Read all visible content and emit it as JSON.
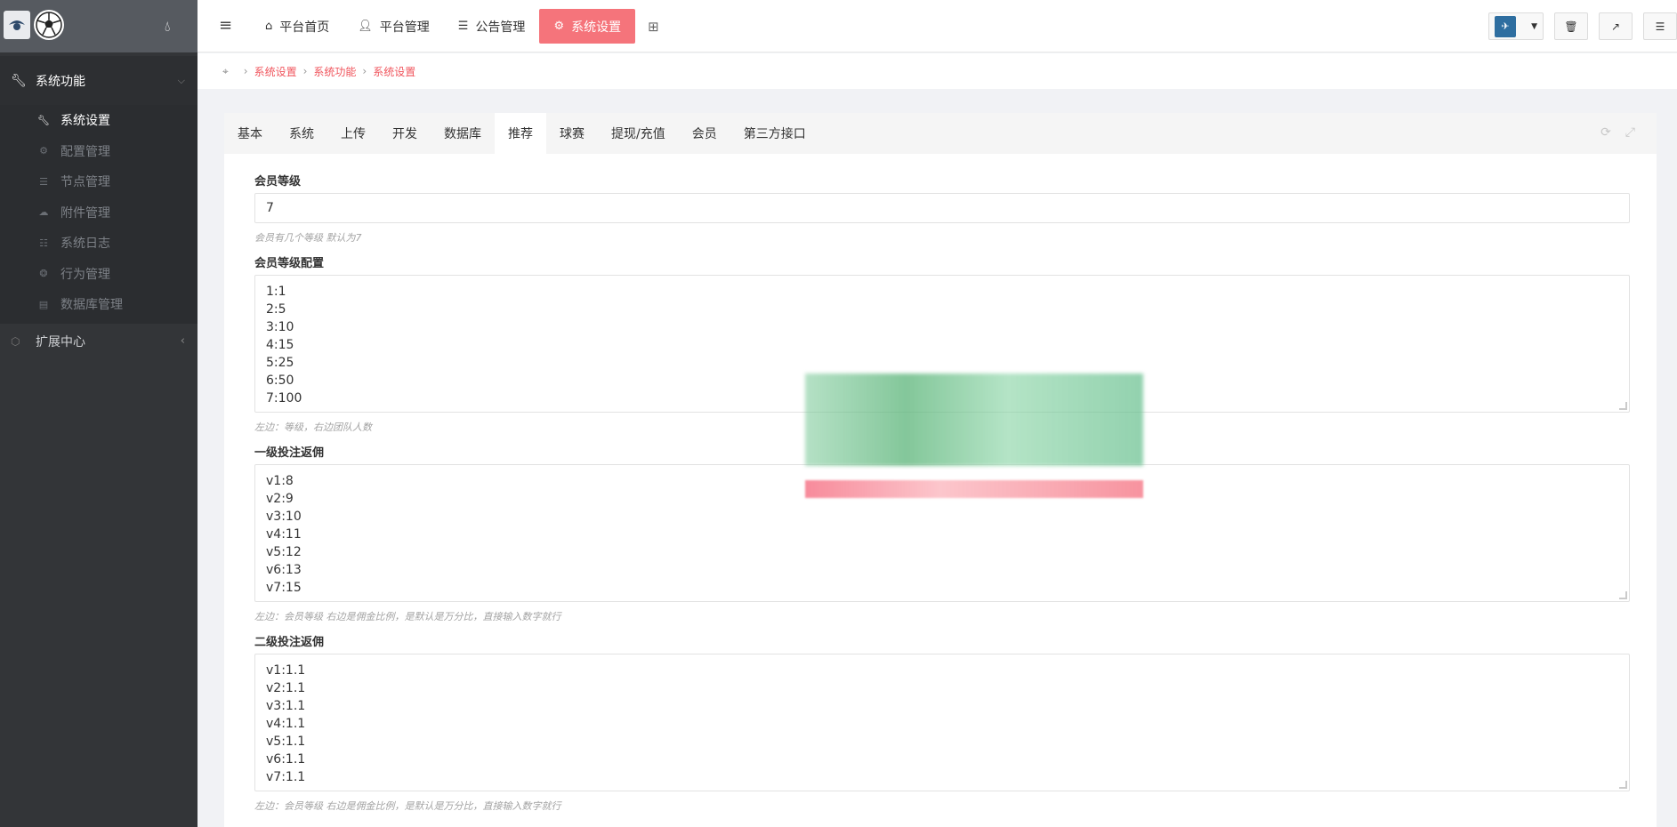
{
  "sidebar": {
    "group1": {
      "label": "系统功能",
      "icon": "wrench-icon"
    },
    "items": [
      {
        "label": "系统设置",
        "icon": "wrench-icon",
        "active": true
      },
      {
        "label": "配置管理",
        "icon": "cogs-icon"
      },
      {
        "label": "节点管理",
        "icon": "list-icon"
      },
      {
        "label": "附件管理",
        "icon": "cloud-icon"
      },
      {
        "label": "系统日志",
        "icon": "log-icon"
      },
      {
        "label": "行为管理",
        "icon": "bug-icon"
      },
      {
        "label": "数据库管理",
        "icon": "trash-icon"
      }
    ],
    "group2": {
      "label": "扩展中心",
      "icon": "cube-icon"
    }
  },
  "topnav": {
    "items": [
      {
        "label": "平台首页",
        "icon": "home-icon"
      },
      {
        "label": "平台管理",
        "icon": "user-icon"
      },
      {
        "label": "公告管理",
        "icon": "list-alt-icon"
      },
      {
        "label": "系统设置",
        "icon": "gear-icon",
        "active": true
      }
    ]
  },
  "breadcrumb": [
    "系统设置",
    "系统功能",
    "系统设置"
  ],
  "tabs": [
    "基本",
    "系统",
    "上传",
    "开发",
    "数据库",
    "推荐",
    "球赛",
    "提现/充值",
    "会员",
    "第三方接口"
  ],
  "active_tab": "推荐",
  "fields": {
    "level": {
      "label": "会员等级",
      "value": "7",
      "help": "会员有几个等级 默认为7"
    },
    "level_config": {
      "label": "会员等级配置",
      "lines": [
        "1:1",
        "2:5",
        "3:10",
        "4:15",
        "5:25",
        "6:50",
        "7:100"
      ],
      "help": "左边：等级，右边团队人数"
    },
    "first_rebate": {
      "label": "一级投注返佣",
      "lines": [
        "v1:8",
        "v2:9",
        "v3:10",
        "v4:11",
        "v5:12",
        "v6:13",
        "v7:15"
      ],
      "help": "左边：会员等级 右边是佣金比例，是默认是万分比，直接输入数字就行"
    },
    "second_rebate": {
      "label": "二级投注返佣",
      "lines": [
        "v1:1.1",
        "v2:1.1",
        "v3:1.1",
        "v4:1.1",
        "v5:1.1",
        "v6:1.1",
        "v7:1.1"
      ],
      "help": "左边：会员等级 右边是佣金比例，是默认是万分比，直接输入数字就行"
    }
  },
  "colors": {
    "accent": "#f5747b",
    "sidebar": "#333538",
    "link": "#f0555d"
  }
}
